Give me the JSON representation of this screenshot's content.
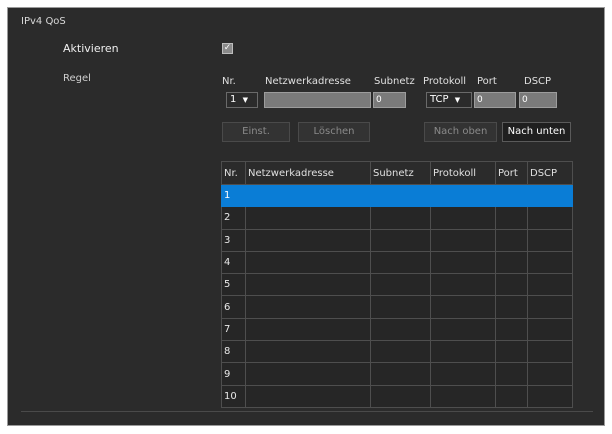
{
  "section_title": "IPv4 QoS",
  "activate": {
    "label": "Aktivieren",
    "checked": true,
    "check_glyph": "✓"
  },
  "rule": {
    "label": "Regel",
    "headers": {
      "nr": "Nr.",
      "address": "Netzwerkadresse",
      "subnet": "Subnetz",
      "protocol": "Protokoll",
      "port": "Port",
      "dscp": "DSCP"
    },
    "nr_value": "1",
    "address_value": "",
    "subnet_value": "0",
    "protocol_value": "TCP",
    "port_value": "0",
    "dscp_value": "0",
    "dropdown_glyph": "▼"
  },
  "buttons": {
    "set": "Einst.",
    "delete": "Löschen",
    "up": "Nach oben",
    "down": "Nach unten"
  },
  "table": {
    "columns": [
      "Nr.",
      "Netzwerkadresse",
      "Subnetz",
      "Protokoll",
      "Port",
      "DSCP"
    ],
    "rows": [
      "1",
      "2",
      "3",
      "4",
      "5",
      "6",
      "7",
      "8",
      "9",
      "10"
    ],
    "selected_row": 1
  },
  "colors": {
    "panel_bg": "#2b2b2b",
    "selection": "#0a7dd6"
  }
}
